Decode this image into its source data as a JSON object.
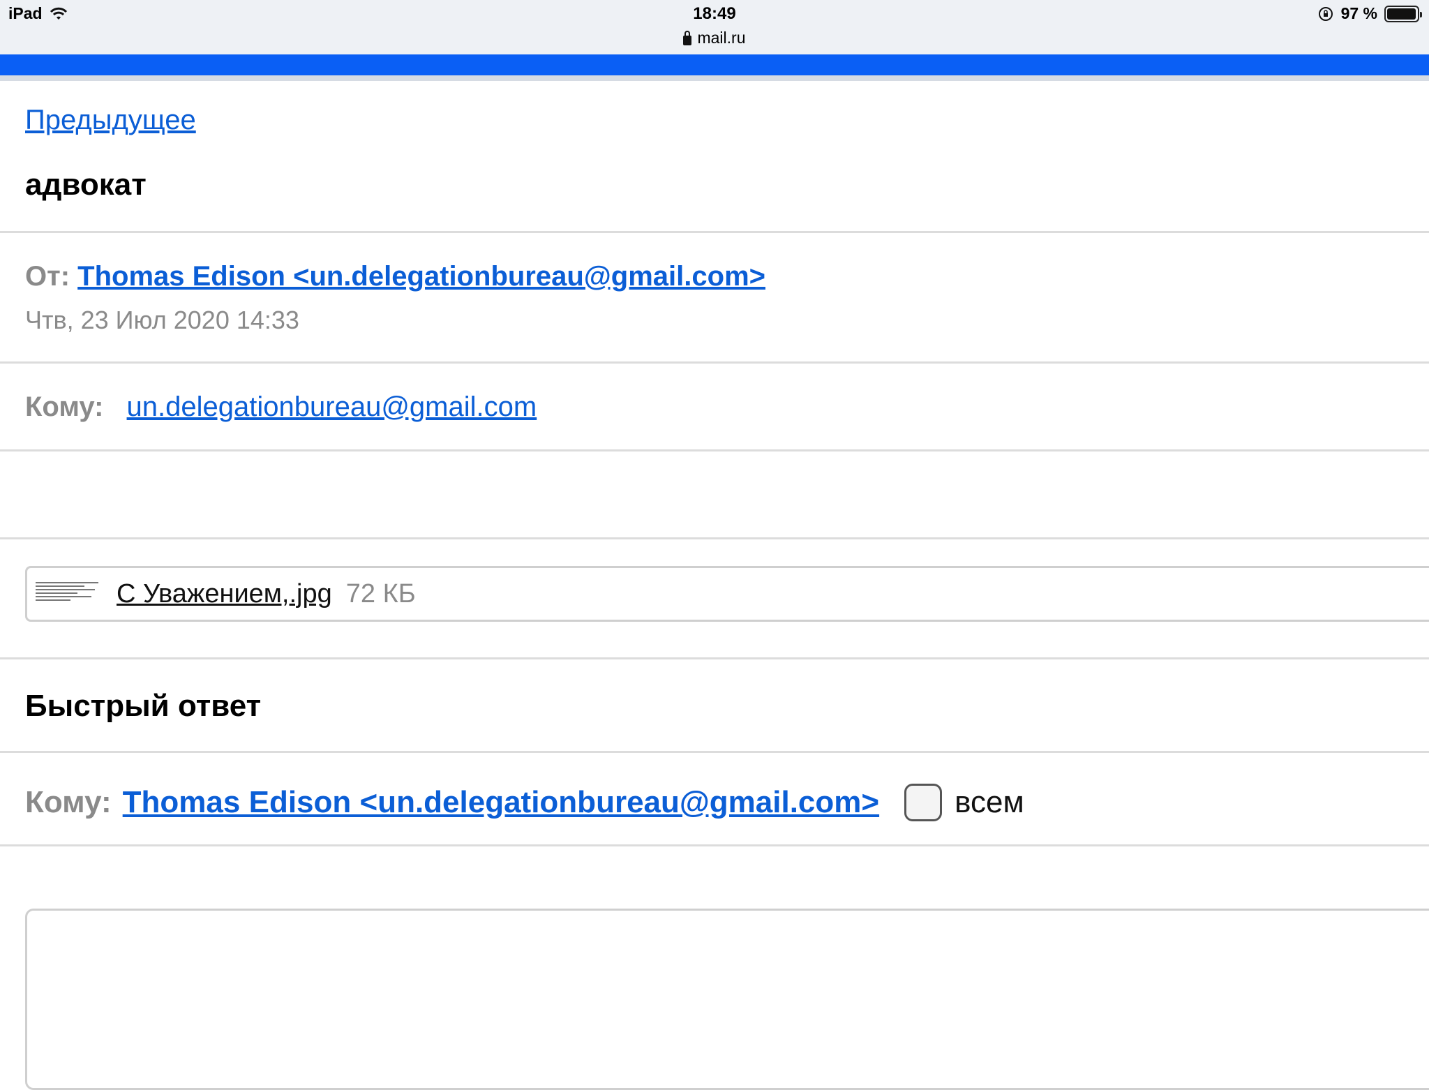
{
  "status_bar": {
    "device": "iPad",
    "time": "18:49",
    "url": "mail.ru",
    "battery_text": "97 %",
    "battery_level": 0.97
  },
  "email": {
    "prev_link": "Предыдущее",
    "subject": "адвокат",
    "from_label": "От:",
    "from_value": "Thomas Edison <un.delegationbureau@gmail.com>",
    "date": "Чтв, 23 Июл 2020 14:33",
    "to_label": "Кому:",
    "to_value": "un.delegationbureau@gmail.com",
    "attachment": {
      "name": "С Уважением,.jpg",
      "size": "72 КБ"
    }
  },
  "quick_reply": {
    "title": "Быстрый ответ",
    "to_label": "Кому:",
    "to_value": "Thomas Edison <un.delegationbureau@gmail.com>",
    "all_label": "всем",
    "all_checked": false
  },
  "colors": {
    "accent": "#0a5ff5",
    "link": "#0b5ed6",
    "muted": "#8a8a8a"
  }
}
